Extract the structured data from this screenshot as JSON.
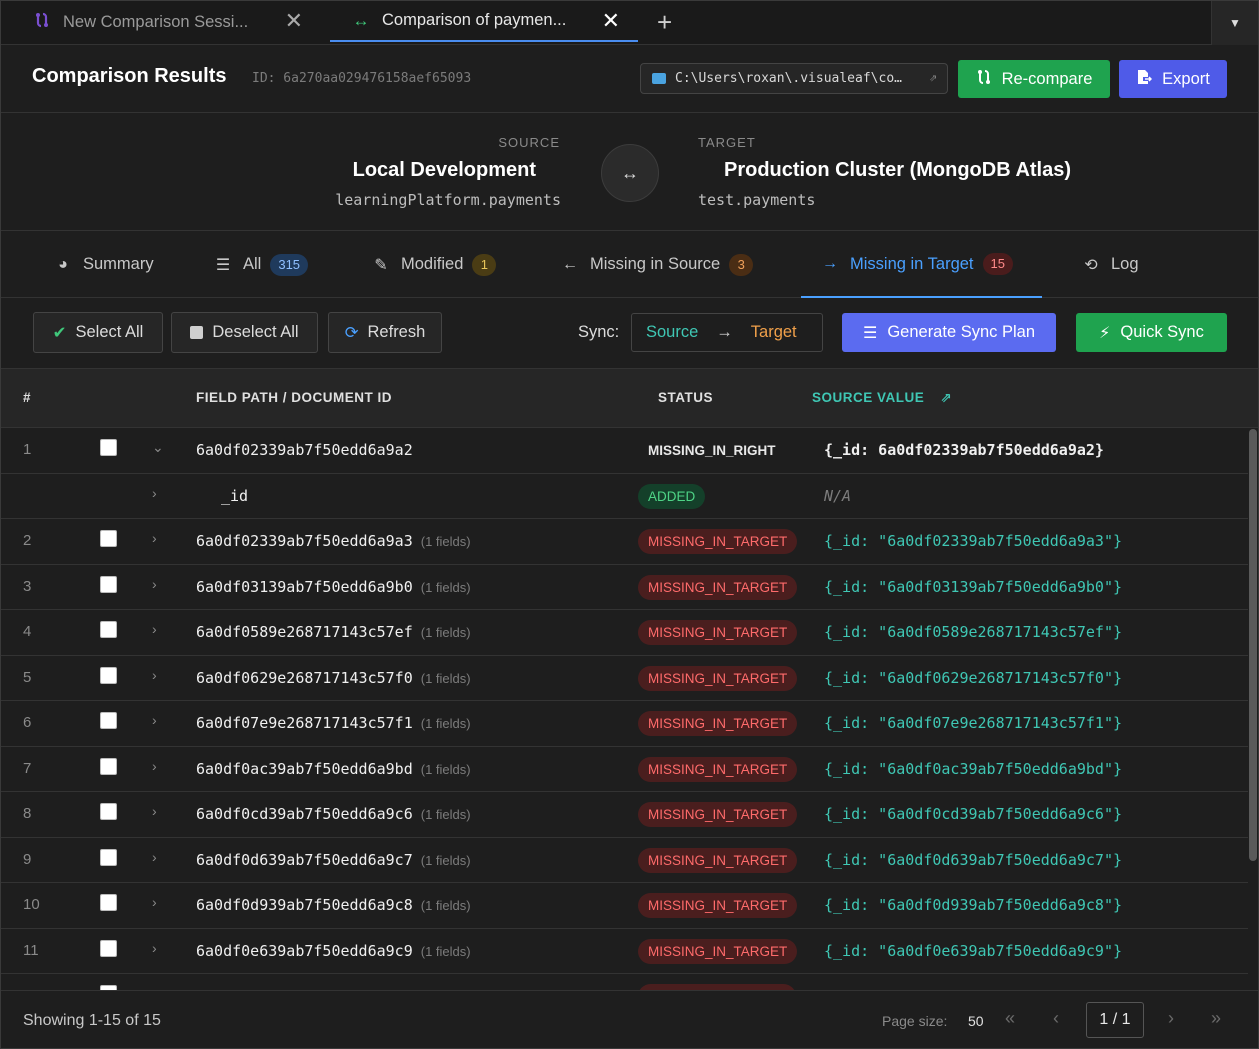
{
  "tabs": [
    {
      "label": "New Comparison Sessi...",
      "icon": "compare-icon"
    },
    {
      "label": "Comparison of paymen...",
      "icon": "swap-arrows-icon"
    }
  ],
  "header": {
    "title": "Comparison Results",
    "id_text": "ID: 6a270aa029476158aef65093",
    "path": "C:\\Users\\roxan\\.visualeaf\\co…",
    "recompare_label": "Re-compare",
    "export_label": "Export"
  },
  "source": {
    "label": "SOURCE",
    "name": "Local Development",
    "collection": "learningPlatform.payments"
  },
  "target": {
    "label": "TARGET",
    "name": "Production Cluster (MongoDB Atlas)",
    "collection": "test.payments"
  },
  "category_tabs": {
    "summary": "Summary",
    "all": "All",
    "all_count": "315",
    "modified": "Modified",
    "modified_count": "1",
    "missing_source": "Missing in Source",
    "missing_source_count": "3",
    "missing_target": "Missing in Target",
    "missing_target_count": "15",
    "log": "Log"
  },
  "toolbar": {
    "select_all": "Select All",
    "deselect_all": "Deselect All",
    "refresh": "Refresh",
    "sync_label": "Sync:",
    "sync_source": "Source",
    "sync_arrow": "→",
    "sync_target": "Target",
    "generate_plan": "Generate Sync Plan",
    "quick_sync": "Quick Sync"
  },
  "table": {
    "headers": {
      "num": "#",
      "path": "FIELD PATH / DOCUMENT ID",
      "status": "STATUS",
      "source_value": "SOURCE VALUE"
    },
    "rows": [
      {
        "num": "1",
        "id": "6a0df02339ab7f50edd6a9a2",
        "fields": "",
        "status": "MISSING_IN_RIGHT",
        "value": "{_id: 6a0df02339ab7f50edd6a9a2}",
        "kind": "expanded"
      },
      {
        "num": "",
        "id": "_id",
        "fields": "",
        "status": "ADDED",
        "value": "N/A",
        "kind": "child"
      },
      {
        "num": "2",
        "id": "6a0df02339ab7f50edd6a9a3",
        "fields": "(1 fields)",
        "status": "MISSING_IN_TARGET",
        "value": "{_id: \"6a0df02339ab7f50edd6a9a3\"}",
        "kind": "doc"
      },
      {
        "num": "3",
        "id": "6a0df03139ab7f50edd6a9b0",
        "fields": "(1 fields)",
        "status": "MISSING_IN_TARGET",
        "value": "{_id: \"6a0df03139ab7f50edd6a9b0\"}",
        "kind": "doc"
      },
      {
        "num": "4",
        "id": "6a0df0589e268717143c57ef",
        "fields": "(1 fields)",
        "status": "MISSING_IN_TARGET",
        "value": "{_id: \"6a0df0589e268717143c57ef\"}",
        "kind": "doc"
      },
      {
        "num": "5",
        "id": "6a0df0629e268717143c57f0",
        "fields": "(1 fields)",
        "status": "MISSING_IN_TARGET",
        "value": "{_id: \"6a0df0629e268717143c57f0\"}",
        "kind": "doc"
      },
      {
        "num": "6",
        "id": "6a0df07e9e268717143c57f1",
        "fields": "(1 fields)",
        "status": "MISSING_IN_TARGET",
        "value": "{_id: \"6a0df07e9e268717143c57f1\"}",
        "kind": "doc"
      },
      {
        "num": "7",
        "id": "6a0df0ac39ab7f50edd6a9bd",
        "fields": "(1 fields)",
        "status": "MISSING_IN_TARGET",
        "value": "{_id: \"6a0df0ac39ab7f50edd6a9bd\"}",
        "kind": "doc"
      },
      {
        "num": "8",
        "id": "6a0df0cd39ab7f50edd6a9c6",
        "fields": "(1 fields)",
        "status": "MISSING_IN_TARGET",
        "value": "{_id: \"6a0df0cd39ab7f50edd6a9c6\"}",
        "kind": "doc"
      },
      {
        "num": "9",
        "id": "6a0df0d639ab7f50edd6a9c7",
        "fields": "(1 fields)",
        "status": "MISSING_IN_TARGET",
        "value": "{_id: \"6a0df0d639ab7f50edd6a9c7\"}",
        "kind": "doc"
      },
      {
        "num": "10",
        "id": "6a0df0d939ab7f50edd6a9c8",
        "fields": "(1 fields)",
        "status": "MISSING_IN_TARGET",
        "value": "{_id: \"6a0df0d939ab7f50edd6a9c8\"}",
        "kind": "doc"
      },
      {
        "num": "11",
        "id": "6a0df0e639ab7f50edd6a9c9",
        "fields": "(1 fields)",
        "status": "MISSING_IN_TARGET",
        "value": "{_id: \"6a0df0e639ab7f50edd6a9c9\"}",
        "kind": "doc"
      }
    ]
  },
  "footer": {
    "showing": "Showing 1-15 of 15",
    "page_size_label": "Page size:",
    "page_size": "50",
    "page": "1 / 1"
  },
  "colors": {
    "accent": "#4aa0ff",
    "success": "#1fa34f",
    "primary": "#4f5be8",
    "teal": "#3fc7b4",
    "danger": "#ff6b6b"
  }
}
